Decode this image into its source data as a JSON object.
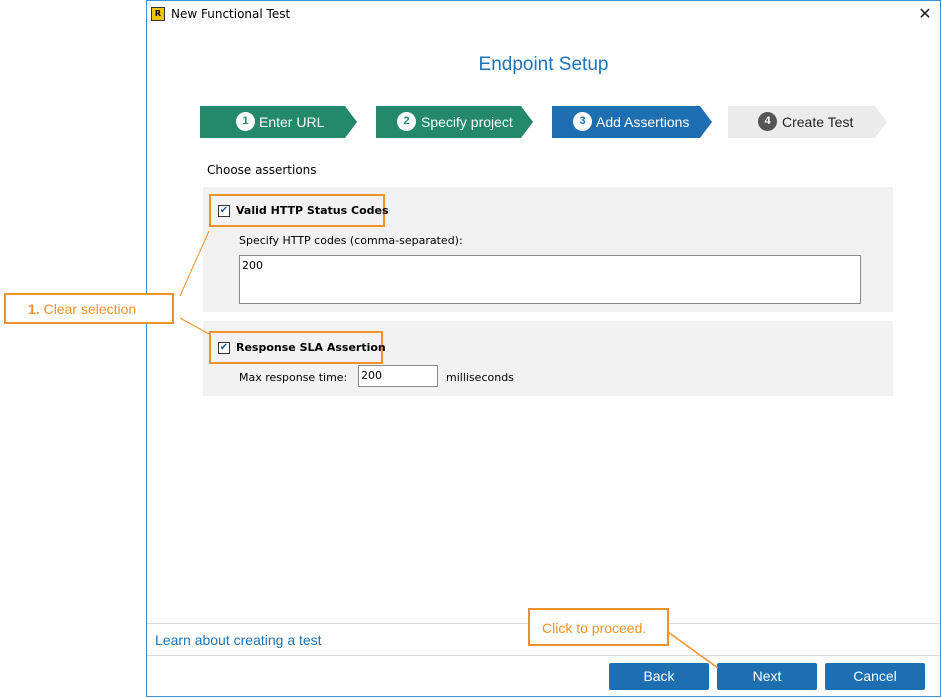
{
  "window": {
    "title": "New Functional Test",
    "close_icon": "close-icon",
    "app_icon_text": "R"
  },
  "heading": "Endpoint Setup",
  "steps": [
    {
      "number": "1",
      "label": "Enter URL",
      "state": "done",
      "color": "#23896a"
    },
    {
      "number": "2",
      "label": "Specify project",
      "state": "done",
      "color": "#23896a"
    },
    {
      "number": "3",
      "label": "Add Assertions",
      "state": "current",
      "color": "#1e6fb2"
    },
    {
      "number": "4",
      "label": "Create Test",
      "state": "pending",
      "color": "#ececec"
    }
  ],
  "choose_label": "Choose assertions",
  "assertions": {
    "http": {
      "label": "Valid HTTP Status Codes",
      "checked": true,
      "codes_label": "Specify HTTP codes (comma-separated):",
      "codes_value": "200"
    },
    "sla": {
      "label": "Response SLA Assertion",
      "checked": true,
      "max_label": "Max response time:",
      "max_value": "200",
      "unit": "milliseconds"
    }
  },
  "learn_link": "Learn about creating a test",
  "buttons": {
    "back": "Back",
    "next": "Next",
    "cancel": "Cancel"
  },
  "callouts": {
    "clear_number": "1.",
    "clear_text": "Clear selection",
    "proceed": "Click to proceed."
  },
  "colors": {
    "accent": "#1e6fb2",
    "done_step": "#23896a",
    "callout": "#f0922b"
  }
}
